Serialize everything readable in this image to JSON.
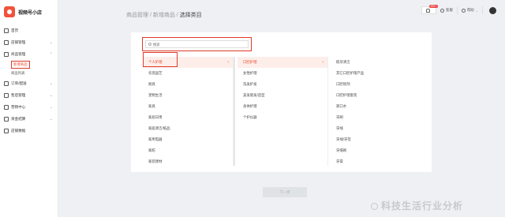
{
  "app": {
    "name": "视频号小店"
  },
  "sidebar": {
    "items": [
      {
        "label": "首页",
        "icon": "home-icon",
        "expandable": false
      },
      {
        "label": "店铺管理",
        "icon": "store-icon",
        "expandable": true
      },
      {
        "label": "商品管理",
        "icon": "goods-icon",
        "expandable": true,
        "expanded": true
      },
      {
        "label": "订单/配送",
        "icon": "order-icon",
        "expandable": true
      },
      {
        "label": "售后管理",
        "icon": "aftersale-icon",
        "expandable": true
      },
      {
        "label": "营销中心",
        "icon": "marketing-icon",
        "expandable": true
      },
      {
        "label": "资金结算",
        "icon": "finance-icon",
        "expandable": true
      },
      {
        "label": "店铺数据",
        "icon": "data-icon",
        "expandable": false
      }
    ],
    "sub_items": [
      {
        "label": "新增商品",
        "active": true
      },
      {
        "label": "商品列表",
        "active": false
      }
    ]
  },
  "header": {
    "breadcrumb": [
      "商品管理",
      "新增商品",
      "选择类目"
    ],
    "notification_badge": "999+",
    "service_label": "客服",
    "help_label": "帮助"
  },
  "search": {
    "placeholder": "搜索"
  },
  "columns": {
    "level1": [
      "个人护理",
      "农资园艺",
      "厨具",
      "宠物生活",
      "家具",
      "家居日用",
      "家庭清洁/纸品",
      "家用电器",
      "家纺",
      "家装建材"
    ],
    "level2": [
      "口腔护理",
      "女性护理",
      "洗发护发",
      "美发假发/造型",
      "身体护理",
      "个护仪器"
    ],
    "level3": [
      "假牙清洁",
      "其它口腔护理产品",
      "口腔喷剂",
      "口腔护理套装",
      "漱口水",
      "牙刷",
      "牙线",
      "牙线/牙签",
      "牙缝刷",
      "牙膏"
    ]
  },
  "footer": {
    "next_label": "下一步"
  },
  "watermark": {
    "text": "科技生活行业分析"
  },
  "colors": {
    "accent": "#e64a2e",
    "highlight_bg": "#fdeeea",
    "page_bg": "#eef0f3"
  }
}
